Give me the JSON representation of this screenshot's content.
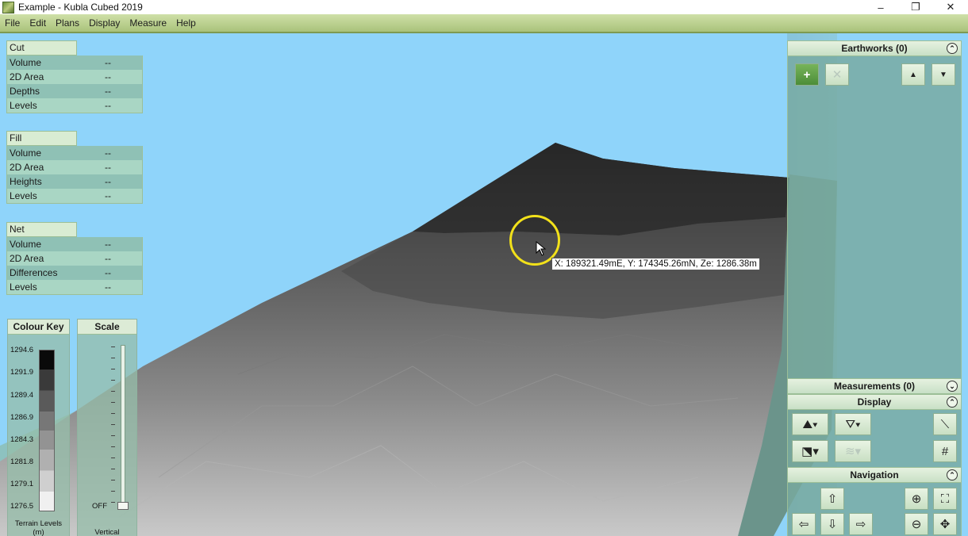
{
  "window": {
    "title": "Example - Kubla Cubed 2019",
    "controls": [
      "–",
      "❐",
      "✕"
    ]
  },
  "menu": [
    "File",
    "Edit",
    "Plans",
    "Display",
    "Measure",
    "Help"
  ],
  "cut": {
    "title": "Cut",
    "rows": [
      {
        "label": "Volume",
        "value": "--"
      },
      {
        "label": "2D Area",
        "value": "--"
      },
      {
        "label": "Depths",
        "value": "--"
      },
      {
        "label": "Levels",
        "value": "--"
      }
    ]
  },
  "fill": {
    "title": "Fill",
    "rows": [
      {
        "label": "Volume",
        "value": "--"
      },
      {
        "label": "2D Area",
        "value": "--"
      },
      {
        "label": "Heights",
        "value": "--"
      },
      {
        "label": "Levels",
        "value": "--"
      }
    ]
  },
  "net": {
    "title": "Net",
    "rows": [
      {
        "label": "Volume",
        "value": "--"
      },
      {
        "label": "2D Area",
        "value": "--"
      },
      {
        "label": "Differences",
        "value": "--"
      },
      {
        "label": "Levels",
        "value": "--"
      }
    ]
  },
  "colour_key": {
    "title": "Colour Key",
    "ticks": [
      "1294.6",
      "1291.9",
      "1289.4",
      "1286.9",
      "1284.3",
      "1281.8",
      "1279.1",
      "1276.5"
    ],
    "footer_line1": "Terrain Levels",
    "footer_line2": "(m)"
  },
  "scale": {
    "title": "Scale",
    "off_label": "OFF",
    "footer": "Vertical Exaggeration"
  },
  "tooltip": "X: 189321.49mE, Y: 174345.26mN, Ze: 1286.38m",
  "right_panel": {
    "earthworks": "Earthworks (0)",
    "measurements": "Measurements (0)",
    "display": "Display",
    "navigation": "Navigation"
  },
  "colors": {
    "sky": "#8fd4fa",
    "menubar": "#b9d08a",
    "panel": "#8fc1b5"
  }
}
